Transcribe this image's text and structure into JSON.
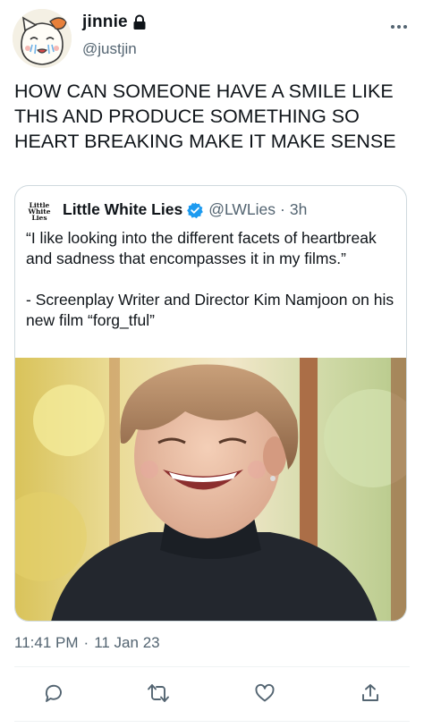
{
  "author": {
    "display_name": "jinnie",
    "handle": "@justjin",
    "avatar_icon": "cartoon-cat-avatar",
    "protected_icon": "lock-icon"
  },
  "tweet": {
    "text": "HOW CAN SOMEONE HAVE A SMILE LIKE THIS AND PRODUCE SOMETHING SO HEART BREAKING MAKE IT MAKE SENSE",
    "timestamp_time": "11:41 PM",
    "timestamp_sep": "·",
    "timestamp_date": "11 Jan 23"
  },
  "quoted_tweet": {
    "avatar_lines": [
      "Little",
      "White",
      "Lies"
    ],
    "name": "Little White Lies",
    "verified_icon": "verified-badge-icon",
    "handle": "@LWLies",
    "separator": "·",
    "time": "3h",
    "paragraph1": "“I like looking into the different facets of heartbreak and sadness that encompasses it in my films.”",
    "paragraph2": "- Screenplay Writer and Director Kim Namjoon on his new film “forg_tful”",
    "media_description_icon": "photo-smiling-man-black-turtleneck"
  },
  "actions": {
    "reply_icon": "reply-icon",
    "retweet_icon": "retweet-icon",
    "like_icon": "heart-icon",
    "share_icon": "share-icon"
  },
  "colors": {
    "text_primary": "#0f1419",
    "text_secondary": "#536471",
    "border": "#cfd9de",
    "verified": "#1d9bf0"
  }
}
